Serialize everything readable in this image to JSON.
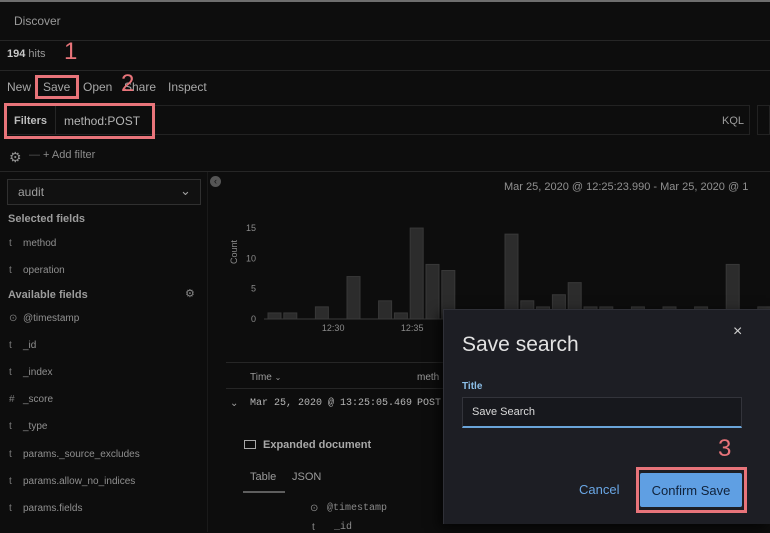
{
  "app": {
    "title": "Discover"
  },
  "hits": {
    "count": "194",
    "label": "hits"
  },
  "menu": {
    "items": [
      "New",
      "Save",
      "Open",
      "Share",
      "Inspect"
    ]
  },
  "filters": {
    "label": "Filters",
    "query": "method:POST",
    "language": "KQL",
    "add_filter": "+ Add filter"
  },
  "index_pattern": {
    "selected": "audit"
  },
  "sidebar": {
    "selected_title": "Selected fields",
    "selected_fields": [
      {
        "type": "t",
        "name": "method"
      },
      {
        "type": "t",
        "name": "operation"
      }
    ],
    "available_title": "Available fields",
    "available_fields": [
      {
        "type": "⊙",
        "name": "@timestamp"
      },
      {
        "type": "t",
        "name": "_id"
      },
      {
        "type": "t",
        "name": "_index"
      },
      {
        "type": "#",
        "name": "_score"
      },
      {
        "type": "t",
        "name": "_type"
      },
      {
        "type": "t",
        "name": "params._source_excludes"
      },
      {
        "type": "t",
        "name": "params.allow_no_indices"
      },
      {
        "type": "t",
        "name": "params.fields"
      }
    ]
  },
  "time_range": "Mar 25, 2020 @ 12:25:23.990 - Mar 25, 2020 @ 1",
  "chart_data": {
    "type": "bar",
    "ylabel": "Count",
    "xlabel": "",
    "y_ticks": [
      "0",
      "5",
      "10",
      "15"
    ],
    "x_ticks": [
      "12:30",
      "12:35"
    ],
    "ylim": [
      0,
      16
    ],
    "values": [
      1,
      1,
      0,
      2,
      0,
      7,
      0,
      3,
      1,
      15,
      9,
      8,
      0,
      0,
      0,
      14,
      3,
      2,
      4,
      6,
      2,
      2,
      0,
      2,
      0,
      2,
      0,
      2,
      0,
      9,
      0,
      2
    ]
  },
  "table": {
    "col_time": "Time",
    "col_method": "meth",
    "row_time": "Mar 25, 2020 @ 13:25:05.469",
    "row_method": "POST"
  },
  "doc": {
    "expanded_label": "Expanded document",
    "tab_table": "Table",
    "tab_json": "JSON",
    "field_ts": "@timestamp",
    "field_id": "_id"
  },
  "modal": {
    "title": "Save search",
    "close": "×",
    "field_label": "Title",
    "input_value": "Save Search",
    "cancel_label": "Cancel",
    "confirm_label": "Confirm Save"
  },
  "annotations": {
    "m1": "1",
    "m2": "2",
    "m3": "3",
    "color": "#e8747a"
  }
}
